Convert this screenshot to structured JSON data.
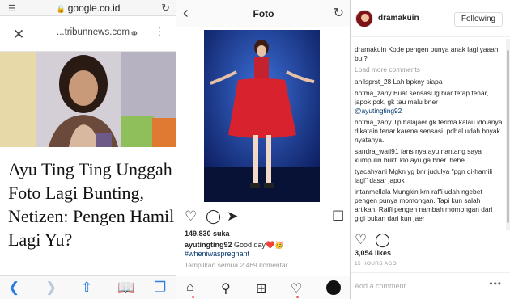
{
  "browser": {
    "url": "google.co.id",
    "site": "...tribunnews.com"
  },
  "article": {
    "headline": "Ayu Ting Ting Unggah Foto Lagi Bunting, Netizen: Pengen Hamil Lagi Yu?"
  },
  "instagram_post": {
    "title": "Foto",
    "likes": "149.830 suka",
    "author": "ayutingting92",
    "caption": "Good day❤️🥳",
    "hashtag": "#wheniwaspregnant",
    "view_all": "Tampilkan semua 2.469 komentar"
  },
  "comments_panel": {
    "username": "dramakuin",
    "follow_label": "Following",
    "load_more": "Load more comments",
    "comments": [
      {
        "user": "dramakuin",
        "text": "Kode pengen punya anak lagi yaaah bul?"
      },
      {
        "user": "anilsprst_28",
        "text": "Lah bpkny siapa"
      },
      {
        "user": "hotma_zany",
        "text": "Buat sensasi lg biar tetap tenar, japok pok, gk tau malu bner"
      },
      {
        "user": "",
        "text": "@ayutingting92"
      },
      {
        "user": "hotma_zany",
        "text": "Tp balajaer gk terima kalau idolanya dikatain tenar karena sensasi, pdhal udah bnyak nyatanya."
      },
      {
        "user": "sandra_watl91",
        "text": "fans nya ayu nantang saya kumpulin bukti klo ayu ga bner..hehe"
      },
      {
        "user": "tyacahyani",
        "text": "Mgkn yg bnr judulya \"pgn di-hamili lagi\" dasar japok"
      },
      {
        "user": "intanmellala",
        "text": "Mungkin krn raffi udah ngebet pengen punya momongan. Tapi kun salah artikan. Raffi pengen nambah momongan dari gigi bukan dari kun jaer"
      }
    ],
    "likes": "3,054 likes",
    "time_ago": "15 HOURS AGO",
    "add_comment_placeholder": "Add a comment..."
  }
}
